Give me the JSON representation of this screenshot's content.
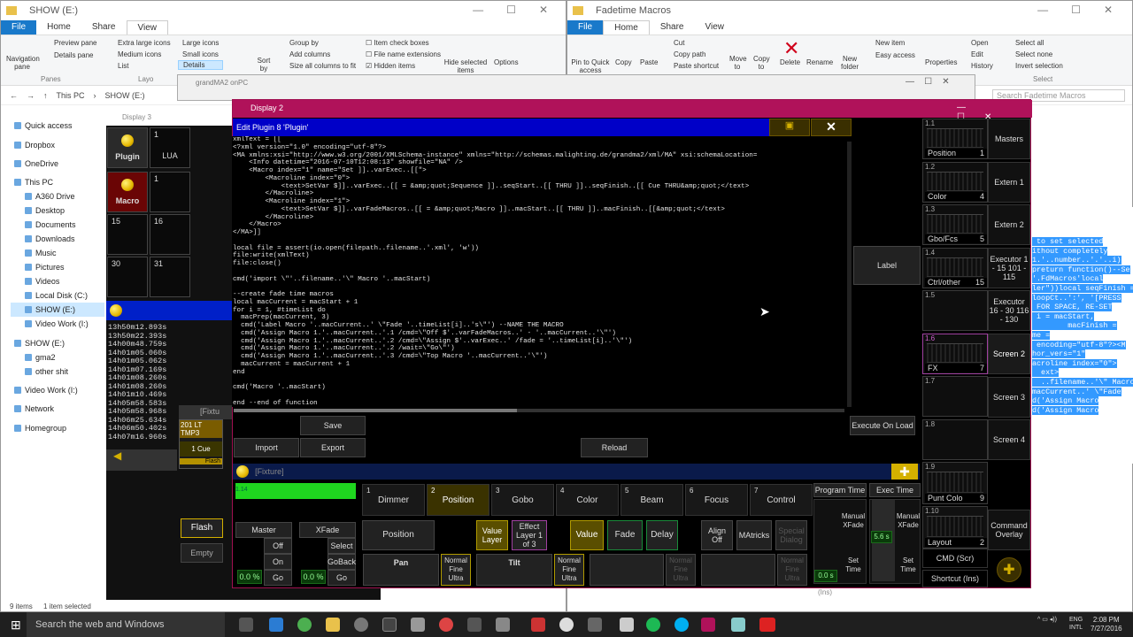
{
  "explorer_left": {
    "title": "SHOW (E:)",
    "tabs": [
      "File",
      "Home",
      "Share",
      "View"
    ],
    "ribbon": {
      "nav_pane": "Navigation pane",
      "preview_pane": "Preview pane",
      "details_pane": "Details pane",
      "panes_group": "Panes",
      "layouts": [
        "Extra large icons",
        "Large icons",
        "Medium icons",
        "Small icons",
        "List",
        "Details"
      ],
      "layout_group": "Layo",
      "sort_by": "Sort by",
      "group_by": "Group by",
      "add_columns": "Add columns",
      "size_cols": "Size all columns to fit",
      "item_check": "Item check boxes",
      "file_ext": "File name extensions",
      "hidden_items": "Hidden items",
      "hide_selected": "Hide selected items",
      "options": "Options"
    },
    "breadcrumb": [
      "This PC",
      "SHOW (E:)"
    ],
    "nav_items": [
      "Quick access",
      "Dropbox",
      "OneDrive",
      "This PC",
      "A360 Drive",
      "Desktop",
      "Documents",
      "Downloads",
      "Music",
      "Pictures",
      "Videos",
      "Local Disk (C:)",
      "SHOW (E:)",
      "Video Work (I:)",
      "SHOW (E:)",
      "gma2",
      "other shit",
      "Video Work (I:)",
      "Network",
      "Homegroup"
    ],
    "status_items": "9 items",
    "status_selected": "1 item selected"
  },
  "explorer_right": {
    "title": "Fadetime Macros",
    "tabs": [
      "File",
      "Home",
      "Share",
      "View"
    ],
    "ribbon": {
      "pin": "Pin to Quick access",
      "copy": "Copy",
      "paste": "Paste",
      "cut": "Cut",
      "copy_path": "Copy path",
      "paste_shortcut": "Paste shortcut",
      "move_to": "Move to",
      "copy_to": "Copy to",
      "delete": "Delete",
      "rename": "Rename",
      "new_folder": "New folder",
      "new_item": "New item",
      "easy_access": "Easy access",
      "properties": "Properties",
      "open": "Open",
      "edit": "Edit",
      "history": "History",
      "select_all": "Select all",
      "select_none": "Select none",
      "invert": "Invert selection",
      "select_group": "Select"
    },
    "search_placeholder": "Search Fadetime Macros"
  },
  "onpc_title": "grandMA2 onPC",
  "display3": {
    "title": "Display 3",
    "plugin": "Plugin",
    "lua": "LUA",
    "macro": "Macro",
    "nums": [
      "1",
      "1",
      "15",
      "16",
      "30",
      "31"
    ],
    "cues": [
      "13h50m12.893s",
      "13h50m22.393s",
      "14h00m48.759s",
      "14h01m05.060s",
      "14h01m05.062s",
      "14h01m07.169s",
      "14h01m08.260s",
      "14h01m08.260s",
      "14h01m10.469s",
      "14h05m58.583s",
      "14h05m58.968s",
      "14h06m25.634s",
      "14h06m50.402s",
      "14h07m16.960s"
    ],
    "fixture_label": "[Fixtu",
    "exec_label": "201 LT TMP3",
    "one_cue": "1 Cue",
    "flash": "Flash",
    "empty": "Empty",
    "flash2": "Flash"
  },
  "display2": {
    "title": "Display 2",
    "editor_title": "Edit Plugin 8 'Plugin'",
    "code": "xmlText = [[\n<?xml version=\"1.0\" encoding=\"utf-8\"?>\n<MA xmlns:xsi=\"http://www.w3.org/2001/XMLSchema-instance\" xmlns=\"http://schemas.malighting.de/grandma2/xml/MA\" xsi:schemaLocation=\n    <Info datetime=\"2016-07-10T12:08:13\" showfile=\"NA\" />\n    <Macro index=\"1\" name=\"Set ]]..varExec..[[\">\n        <Macroline index=\"0\">\n            <text>SetVar $]]..varExec..[[ = &amp;quot;Sequence ]]..seqStart..[[ THRU ]]..seqFinish..[[ Cue THRU&amp;quot;</text>\n        </Macroline>\n        <Macroline index=\"1\">\n            <text>SetVar $]]..varFadeMacros..[[ = &amp;quot;Macro ]]..macStart..[[ THRU ]]..macFinish..[[&amp;quot;</text>\n        </Macroline>\n    </Macro>\n</MA>]]\n\nlocal file = assert(io.open(filepath..filename..'.xml', 'w'))\nfile:write(xmlText)\nfile:close()\n\ncmd('import \\\"'..filename..'\\\" Macro '..macStart)\n\n--create fade time macros\nlocal macCurrent = macStart + 1\nfor i = 1, #timeList do\n  macPrep(macCurrent, 3)\n  cmd('Label Macro '..macCurrent..' \\\"Fade '..timeList[i]..'s\\\"') --NAME THE MACRO\n  cmd('Assign Macro 1.'..macCurrent..'.1 /cmd=\\\"Off $'..varFadeMacros..' - '..macCurrent..'\\\"')\n  cmd('Assign Macro 1.'..macCurrent..'.2 /cmd=\\\"Assign $'..varExec..' /fade = '..timeList[i]..'\\\"')\n  cmd('Assign Macro 1.'..macCurrent..'.2 /wait=\\\"Go\\\"')\n  cmd('Assign Macro 1.'..macCurrent..'.3 /cmd=\\\"Top Macro '..macCurrent..'\\\"')\n  macCurrent = macCurrent + 1\nend\n\ncmd('Macro '..macStart)\n\nend --end of function",
    "label_btn": "Label",
    "save": "Save",
    "import": "Import",
    "export": "Export",
    "reload": "Reload",
    "execute_on_load": "Execute On Load",
    "fixture_bar": "[Fixture]",
    "fixture_val": "1.14",
    "master": "Master",
    "xfade": "XFade",
    "off": "Off",
    "on": "On",
    "select": "Select",
    "goback": "GoBack",
    "go": "Go",
    "pct1": "0.0 %",
    "pct2": "0.0 %",
    "features": [
      {
        "num": "1",
        "label": "Dimmer"
      },
      {
        "num": "2",
        "label": "Position"
      },
      {
        "num": "3",
        "label": "Gobo"
      },
      {
        "num": "4",
        "label": "Color"
      },
      {
        "num": "5",
        "label": "Beam"
      },
      {
        "num": "6",
        "label": "Focus"
      },
      {
        "num": "7",
        "label": "Control"
      }
    ],
    "position_btn": "Position",
    "value_layer": "Value Layer",
    "effect_layer": "Effect Layer 1 of 3",
    "value": "Value",
    "fade": "Fade",
    "delay": "Delay",
    "align_off": "Align Off",
    "matricks": "MAtricks",
    "special_dialog": "Special Dialog",
    "pan": "Pan",
    "tilt": "Tilt",
    "normal_fine_ultra": "Normal Fine Ultra",
    "program_time": "Program Time",
    "exec_time": "Exec Time",
    "manual_xfade": "Manual XFade",
    "set_time": "Set Time",
    "time1": "0.0 s",
    "time2": "5.6 s",
    "ins": "(Ins)"
  },
  "presets": [
    {
      "id": "1.1",
      "label": "Position",
      "n": "1"
    },
    {
      "id": "1.2",
      "label": "Color",
      "n": "4"
    },
    {
      "id": "1.3",
      "label": "Gbo/Fcs",
      "n": "5"
    },
    {
      "id": "1.4",
      "label": "Ctrl/other",
      "n": "15"
    },
    {
      "id": "1.5",
      "label": "",
      "n": ""
    },
    {
      "id": "1.6",
      "label": "FX",
      "n": "7"
    },
    {
      "id": "1.7",
      "label": "",
      "n": ""
    },
    {
      "id": "1.8",
      "label": "",
      "n": ""
    },
    {
      "id": "1.9",
      "label": "Punt Colo",
      "n": "9"
    },
    {
      "id": "1.10",
      "label": "Layout",
      "n": "2"
    }
  ],
  "right_buttons": [
    "Masters",
    "Extern 1",
    "Extern 2",
    "Executor 1 - 15 101 - 115",
    "Executor 16 - 30 116 - 130",
    "Screen 2",
    "Screen 3",
    "Screen 4",
    "Command Overlay"
  ],
  "cmd": "CMD (Scr)",
  "shortcut": "Shortcut (Ins)",
  "selected_text": [
    " to set selected",
    "ithout completely",
    "1.'..number..'.'..i)",
    "preturn function()--Se",
    "'.FdMacros'local",
    "ler\"))local seqFinish =",
    "loopCt..':', '[PRESS",
    " FOR SPACE, RE-SET",
    " i = macStart,",
    "        macFinish =",
    "me =",
    " encoding=\"utf-8\"?><M",
    "",
    "hor_vers=\"1\"",
    "acroline index=\"0\">",
    "  ext>",
    "  ..filename..'\\\" Macro",
    "macCurrent..' \\\"Fade",
    "d('Assign Macro",
    "d('Assign Macro"
  ],
  "taskbar": {
    "search": "Search the web and Windows",
    "lang1": "ENG",
    "lang2": "INTL",
    "time": "2:08 PM",
    "date": "7/27/2016"
  }
}
